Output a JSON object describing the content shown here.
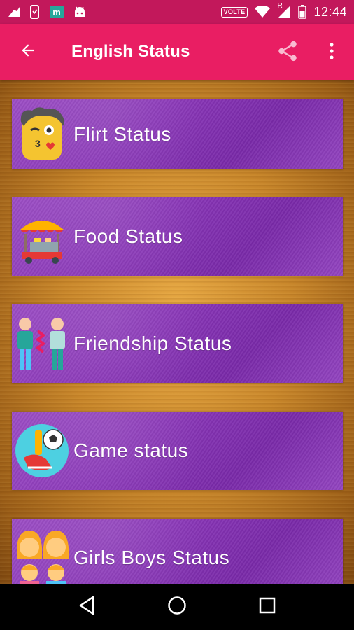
{
  "status_bar": {
    "time": "12:44",
    "volte": "VOLTE",
    "roaming": "R",
    "icons": [
      "gesture-icon",
      "phone-icon",
      "app-m-icon",
      "android-icon",
      "wifi-icon",
      "signal-icon",
      "battery-icon"
    ]
  },
  "app_bar": {
    "title": "English Status",
    "back_icon": "arrow-back-icon",
    "share_icon": "share-icon",
    "more_icon": "more-vert-icon",
    "color": "#e91e63"
  },
  "categories": [
    {
      "label": "Flirt Status",
      "icon": "flirt-emoji-icon"
    },
    {
      "label": "Food Status",
      "icon": "food-stall-icon"
    },
    {
      "label": "Friendship Status",
      "icon": "friends-icon"
    },
    {
      "label": "Game status",
      "icon": "soccer-icon"
    },
    {
      "label": "Girls Boys Status",
      "icon": "family-icon"
    }
  ],
  "nav_bar": {
    "icons": [
      "back-triangle-icon",
      "home-circle-icon",
      "recents-square-icon"
    ]
  },
  "colors": {
    "status_bar": "#c2185b",
    "app_bar": "#e91e63",
    "card": "#8a37b8",
    "background": "#c8862a"
  }
}
